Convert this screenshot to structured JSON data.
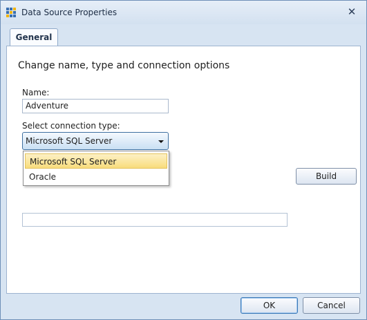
{
  "window": {
    "title": "Data Source Properties",
    "close_glyph": "✕"
  },
  "tabs": [
    {
      "label": "General"
    }
  ],
  "general": {
    "heading": "Change name, type and connection options",
    "name_label": "Name:",
    "name_value": "Adventure",
    "connection_type_label": "Select connection type:",
    "connection_type_selected": "Microsoft SQL Server",
    "connection_type_options": [
      "Microsoft SQL Server",
      "Oracle"
    ],
    "build_label": "Build",
    "connection_string_value": ""
  },
  "footer": {
    "ok_label": "OK",
    "cancel_label": "Cancel"
  },
  "colors": {
    "accent": "#3d79b6",
    "highlight": "#f8dc7c"
  }
}
